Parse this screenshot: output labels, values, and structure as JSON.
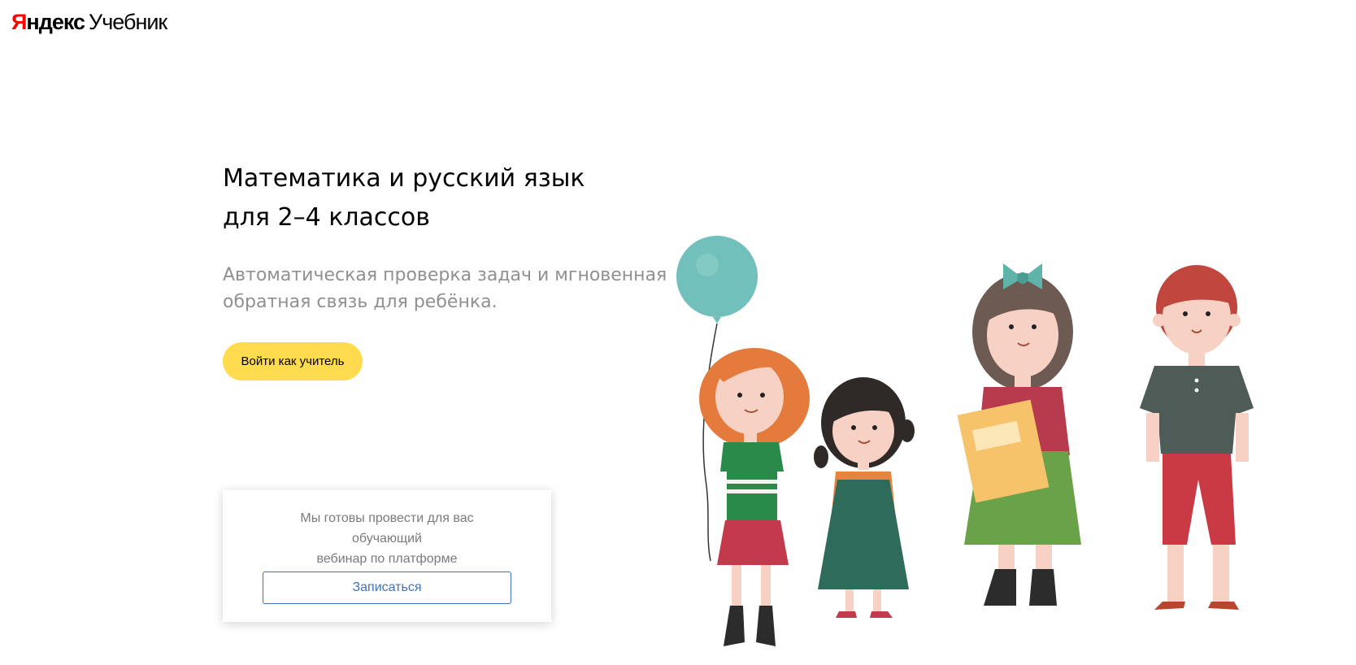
{
  "header": {
    "logo_part1_red": "Я",
    "logo_part1_rest": "ндекс",
    "logo_part2": "Учебник"
  },
  "hero": {
    "title_line1": "Математика и русский язык",
    "title_line2": "для 2–4 классов",
    "subtitle_line1": "Автоматическая проверка задач и мгновенная",
    "subtitle_line2": "обратная связь для ребёнка.",
    "teacher_login_label": "Войти как учитель"
  },
  "webinar": {
    "text_line1": "Мы готовы провести для вас обучающий",
    "text_line2": "вебинар по платформе",
    "signup_label": "Записаться"
  },
  "colors": {
    "primary_button": "#ffdb4d",
    "link_blue": "#3f72b8",
    "logo_red": "#ff0000",
    "subtitle_gray": "#909090"
  },
  "illustration": {
    "icon": "children-with-balloon-illustration"
  }
}
